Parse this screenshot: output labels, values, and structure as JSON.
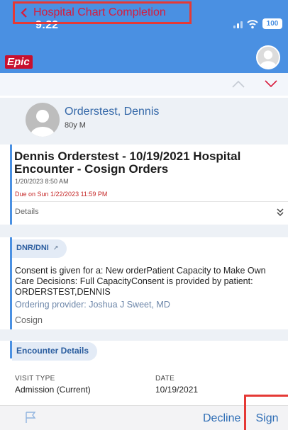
{
  "status_bar": {
    "time": "9:22",
    "battery": "100"
  },
  "brand": {
    "logo": "Epic"
  },
  "nav": {
    "back_label": "Hospital Chart Completion"
  },
  "patient": {
    "name": "Orderstest, Dennis",
    "demographics": "80y M"
  },
  "card": {
    "title": "Dennis Orderstest - 10/19/2021 Hospital Encounter - Cosign Orders",
    "date": "1/20/2023 8:50 AM",
    "due": "Due on Sun 1/22/2023 11:59 PM",
    "details_label": "Details"
  },
  "dnr": {
    "header": "DNR/DNI",
    "text": "Consent is given for a: New orderPatient Capacity to Make Own Care Decisions: Full CapacityConsent is provided by patient: ORDERSTEST,DENNIS",
    "provider": "Ordering provider: Joshua J Sweet, MD",
    "cosign": "Cosign"
  },
  "encounter": {
    "header": "Encounter Details",
    "columns": [
      {
        "label": "VISIT TYPE",
        "value": "Admission (Current)"
      },
      {
        "label": "DATE",
        "value": "10/19/2021"
      }
    ]
  },
  "toolbar": {
    "decline_label": "Decline",
    "sign_label": "Sign"
  },
  "colors": {
    "header_blue": "#4a90e2",
    "epic_red": "#c8102e",
    "highlight_red": "#e53935",
    "link_blue": "#2e6db5"
  },
  "icons": [
    "signal-icon",
    "wifi-icon",
    "battery-icon",
    "avatar-icon",
    "chevron-left-icon",
    "chevron-up-icon",
    "chevron-down-icon",
    "double-chevron-down-icon",
    "flag-icon"
  ]
}
